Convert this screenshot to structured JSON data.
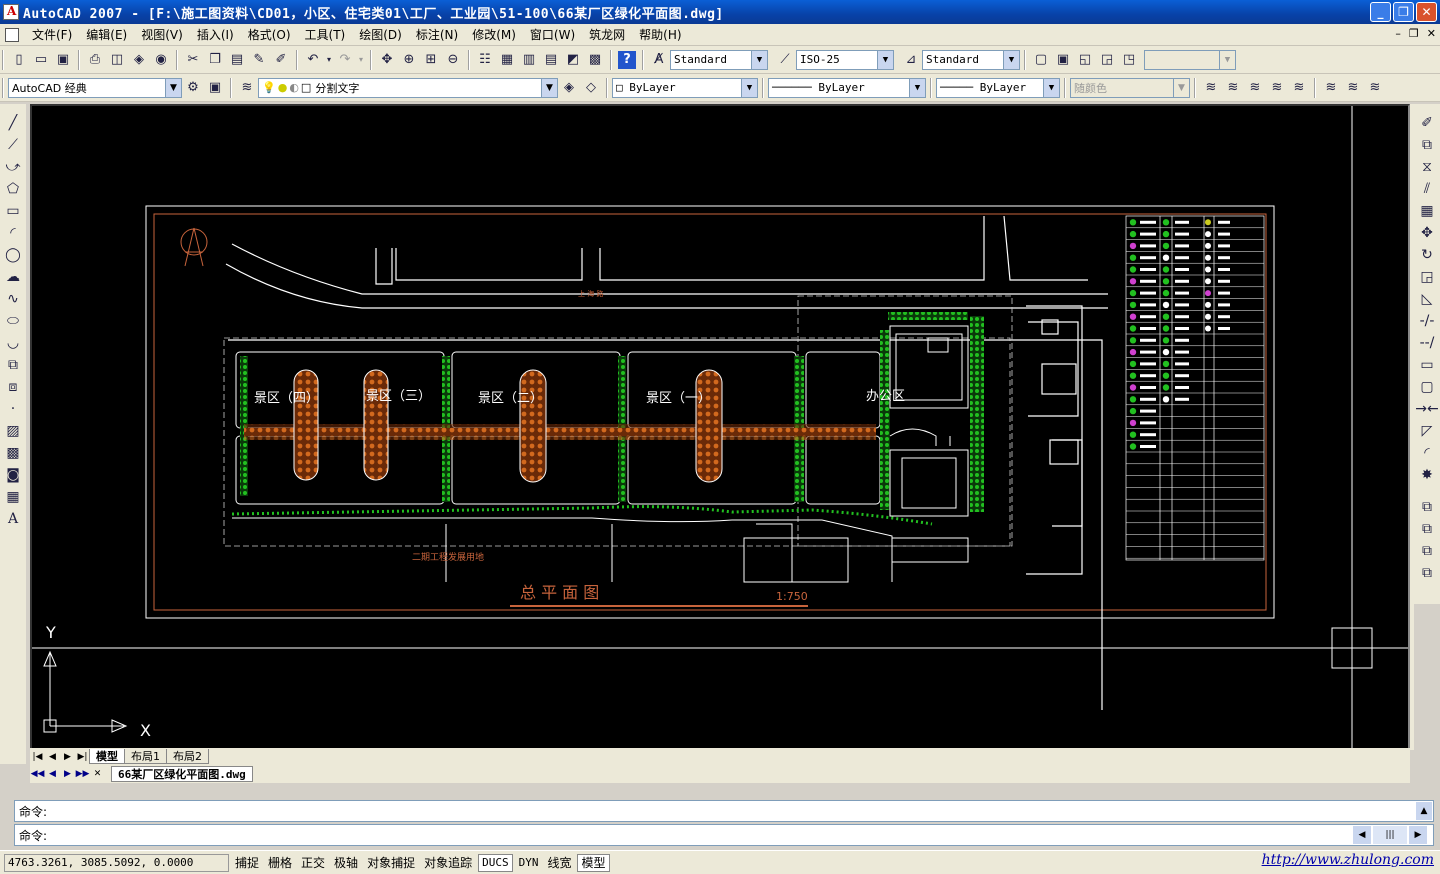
{
  "window": {
    "title": "AutoCAD 2007 - [F:\\施工图资料\\CD01，小区、住宅类01\\工厂、工业园\\51-100\\66某厂区绿化平面图.dwg]",
    "controls": [
      "minimize",
      "maximize",
      "close"
    ]
  },
  "menubar": {
    "items": [
      "文件(F)",
      "编辑(E)",
      "视图(V)",
      "插入(I)",
      "格式(O)",
      "工具(T)",
      "绘图(D)",
      "标注(N)",
      "修改(M)",
      "窗口(W)",
      "筑龙网",
      "帮助(H)"
    ]
  },
  "toolbar1": {
    "text_style": "Standard",
    "dim_style": "ISO-25",
    "table_style": "Standard"
  },
  "toolbar2": {
    "workspace": "AutoCAD 经典",
    "layer": "分割文字",
    "color": "ByLayer",
    "linetype": "ByLayer",
    "lineweight": "ByLayer",
    "plotstyle": "随颜色"
  },
  "drawing": {
    "title": "总  平  面  图",
    "scale": "1:750",
    "road_label": "上  海  路",
    "future_label": "二期工程发展用地",
    "zones": [
      "景区（四）",
      "景区（三）",
      "景区（二）",
      "景区（一）",
      "办公区"
    ],
    "ucs_x": "X",
    "ucs_y": "Y"
  },
  "layout_tabs": [
    "模型",
    "布局1",
    "布局2"
  ],
  "doc_tab": "66某厂区绿化平面图.dwg",
  "command": {
    "line1": "命令:",
    "line2": "命令:"
  },
  "status": {
    "coords": "4763.3261,  3085.5092,  0.0000",
    "buttons": [
      "捕捉",
      "栅格",
      "正交",
      "极轴",
      "对象捕捉",
      "对象追踪",
      "DUCS",
      "DYN",
      "线宽",
      "模型"
    ],
    "active": [
      "DUCS",
      "模型"
    ],
    "url": "http://www.zhulong.com"
  },
  "colors": {
    "title_bar": "#0842a8",
    "canvas": "#000000",
    "drawing_line": "#ffffff",
    "frame_line": "#c8643c",
    "vegetation": "#22c020",
    "paving": "#d2691e"
  }
}
